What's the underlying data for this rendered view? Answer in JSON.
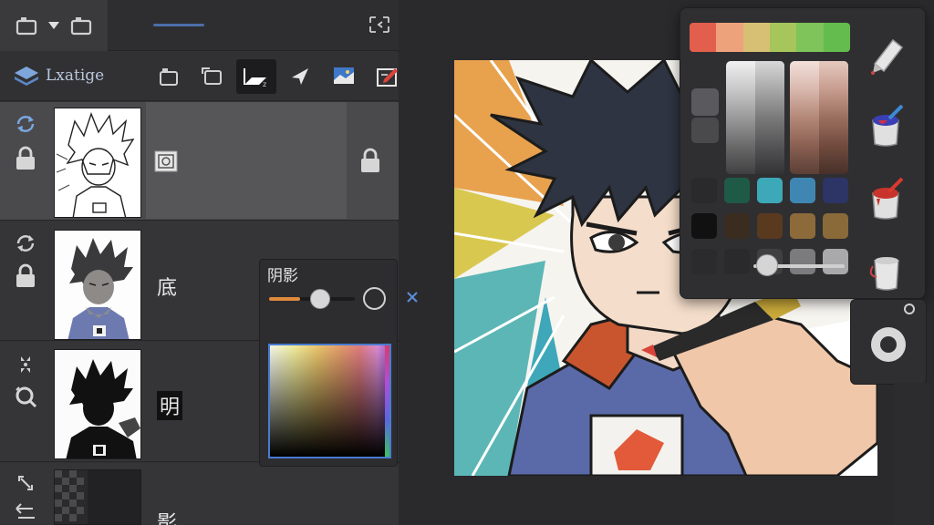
{
  "layers_panel": {
    "title": "Lxatige",
    "layers": [
      {
        "name": "",
        "selected": true
      },
      {
        "name": "底",
        "selected": false
      },
      {
        "name": "明",
        "selected": false
      },
      {
        "name": "影",
        "selected": false
      }
    ]
  },
  "shadow_popup": {
    "title": "阴影",
    "slider_value_fraction": 0.6
  },
  "palette": {
    "hue_strip": [
      "#e25f4d",
      "#eea27b",
      "#d7c074",
      "#a6c55a",
      "#7fc35b",
      "#63bc4d"
    ],
    "grey_swatches": [
      "#4a4a4d",
      "#5c5c60",
      "#4a4a4d"
    ],
    "slider_value_fraction": 0.15,
    "color_swatches": [
      [
        "#2a2a2c",
        "#1e5a45",
        "#3da9b8",
        "#3f87b2",
        "#2c3566"
      ],
      [
        "#111112",
        "#3a2c1f",
        "#5a3a1e",
        "#8d6a3a",
        "#8a6a38"
      ],
      [
        "#2b2b2d",
        "#2a2a2c",
        "#3f3f42",
        "#7b7b7d",
        "#a9a9ab"
      ]
    ]
  },
  "colors": {
    "accent_blue": "#4a7bd0",
    "slider_orange": "#e08a3c"
  }
}
